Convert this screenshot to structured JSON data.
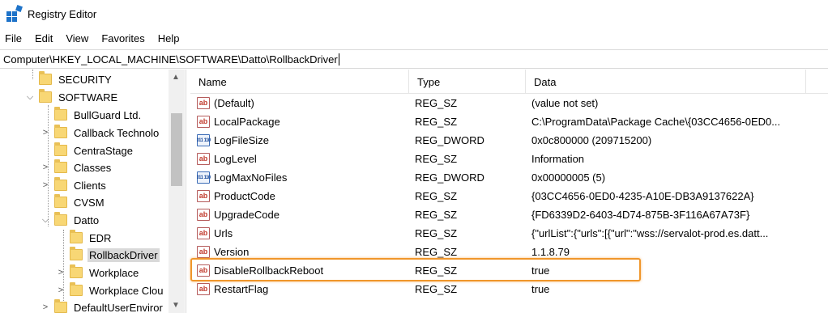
{
  "window": {
    "title": "Registry Editor",
    "app_icon": "registry-editor-icon"
  },
  "menu": [
    "File",
    "Edit",
    "View",
    "Favorites",
    "Help"
  ],
  "address": "Computer\\HKEY_LOCAL_MACHINE\\SOFTWARE\\Datto\\RollbackDriver",
  "tree": [
    {
      "label": "SECURITY",
      "chevron": ""
    },
    {
      "label": "SOFTWARE",
      "chevron": "⌵"
    },
    {
      "label": "BullGuard Ltd.",
      "chevron": ""
    },
    {
      "label": "Callback Technolo",
      "chevron": ">"
    },
    {
      "label": "CentraStage",
      "chevron": ""
    },
    {
      "label": "Classes",
      "chevron": ">"
    },
    {
      "label": "Clients",
      "chevron": ">"
    },
    {
      "label": "CVSM",
      "chevron": ""
    },
    {
      "label": "Datto",
      "chevron": "⌵"
    },
    {
      "label": "EDR",
      "chevron": ""
    },
    {
      "label": "RollbackDriver",
      "chevron": ""
    },
    {
      "label": "Workplace",
      "chevron": ">"
    },
    {
      "label": "Workplace Clou",
      "chevron": ">"
    },
    {
      "label": "DefaultUserEnviror",
      "chevron": ">"
    }
  ],
  "columns": {
    "name": "Name",
    "type": "Type",
    "data": "Data"
  },
  "values": [
    {
      "icon": "ab",
      "name": "(Default)",
      "type": "REG_SZ",
      "data": "(value not set)"
    },
    {
      "icon": "ab",
      "name": "LocalPackage",
      "type": "REG_SZ",
      "data": "C:\\ProgramData\\Package Cache\\{03CC4656-0ED0..."
    },
    {
      "icon": "bin",
      "name": "LogFileSize",
      "type": "REG_DWORD",
      "data": "0x0c800000 (209715200)"
    },
    {
      "icon": "ab",
      "name": "LogLevel",
      "type": "REG_SZ",
      "data": "Information"
    },
    {
      "icon": "bin",
      "name": "LogMaxNoFiles",
      "type": "REG_DWORD",
      "data": "0x00000005 (5)"
    },
    {
      "icon": "ab",
      "name": "ProductCode",
      "type": "REG_SZ",
      "data": "{03CC4656-0ED0-4235-A10E-DB3A9137622A}"
    },
    {
      "icon": "ab",
      "name": "UpgradeCode",
      "type": "REG_SZ",
      "data": "{FD6339D2-6403-4D74-875B-3F116A67A73F}"
    },
    {
      "icon": "ab",
      "name": "Urls",
      "type": "REG_SZ",
      "data": "{\"urlList\":{\"urls\":[{\"url\":\"wss://servalot-prod.es.datt..."
    },
    {
      "icon": "ab",
      "name": "Version",
      "type": "REG_SZ",
      "data": "1.1.8.79"
    },
    {
      "icon": "ab",
      "name": "DisableRollbackReboot",
      "type": "REG_SZ",
      "data": "true"
    },
    {
      "icon": "ab",
      "name": "RestartFlag",
      "type": "REG_SZ",
      "data": "true"
    }
  ],
  "icon_text": {
    "ab": "ab",
    "bin": "011 110"
  },
  "colors": {
    "highlight": "#f0962b",
    "folder": "#f8d775",
    "selection": "#d9d9d9"
  }
}
